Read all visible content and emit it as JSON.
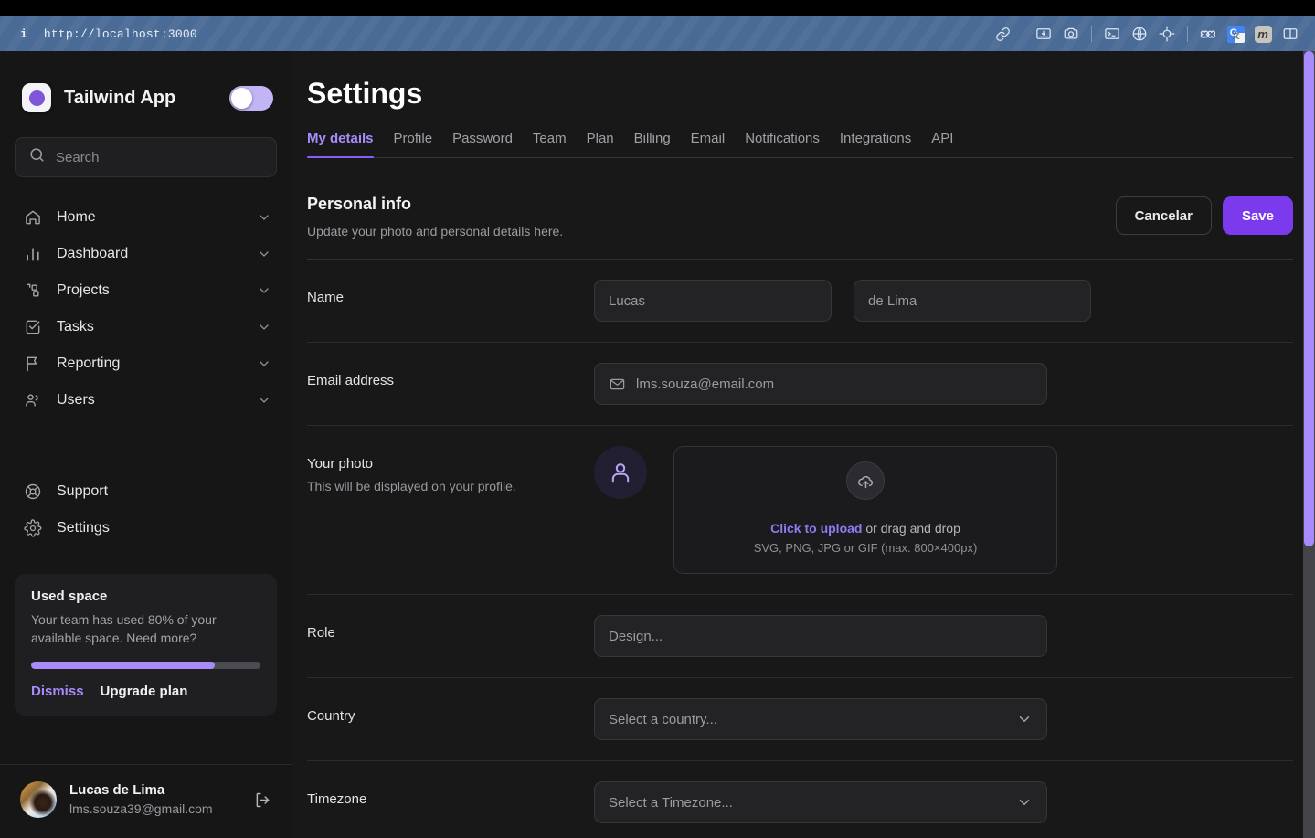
{
  "browser": {
    "info_icon": "info-icon",
    "url": "http://localhost:3000",
    "toolbar_icons": [
      "link-icon",
      "video-save-icon",
      "camera-icon",
      "terminal-icon",
      "globe-icon",
      "target-icon",
      "puzzle-icon",
      "google-translate-icon",
      "mastodon-icon",
      "split-panel-icon"
    ],
    "translate_label": "G",
    "translate_sub": "文",
    "mastodon_label": "m"
  },
  "sidebar": {
    "brand": {
      "name": "Tailwind App",
      "logo_icon": "app-logo-icon"
    },
    "theme_toggle": {
      "state": "off",
      "name": "theme-toggle"
    },
    "search": {
      "placeholder": "Search",
      "icon": "search-icon"
    },
    "nav": [
      {
        "label": "Home",
        "icon": "home-icon"
      },
      {
        "label": "Dashboard",
        "icon": "bar-chart-icon"
      },
      {
        "label": "Projects",
        "icon": "projects-icon"
      },
      {
        "label": "Tasks",
        "icon": "check-square-icon"
      },
      {
        "label": "Reporting",
        "icon": "flag-icon"
      },
      {
        "label": "Users",
        "icon": "users-icon"
      }
    ],
    "nav_secondary": [
      {
        "label": "Support",
        "icon": "lifebuoy-icon"
      },
      {
        "label": "Settings",
        "icon": "gear-icon"
      }
    ],
    "used_space": {
      "title": "Used space",
      "body": "Your team has used 80% of your available space. Need more?",
      "percent": 80,
      "dismiss_label": "Dismiss",
      "upgrade_label": "Upgrade plan",
      "bar_color": "#a78bfa"
    },
    "user": {
      "name": "Lucas de Lima",
      "email": "lms.souza39@gmail.com",
      "avatar": "user-avatar",
      "logout_icon": "logout-icon"
    }
  },
  "main": {
    "page_title": "Settings",
    "tabs": [
      {
        "label": "My details",
        "active": true
      },
      {
        "label": "Profile",
        "active": false
      },
      {
        "label": "Password",
        "active": false
      },
      {
        "label": "Team",
        "active": false
      },
      {
        "label": "Plan",
        "active": false
      },
      {
        "label": "Billing",
        "active": false
      },
      {
        "label": "Email",
        "active": false
      },
      {
        "label": "Notifications",
        "active": false
      },
      {
        "label": "Integrations",
        "active": false
      },
      {
        "label": "API",
        "active": false
      }
    ],
    "section": {
      "title": "Personal info",
      "subtitle": "Update your photo and personal details here.",
      "cancel_label": "Cancelar",
      "save_label": "Save"
    },
    "fields": {
      "name": {
        "label": "Name",
        "first_placeholder": "Lucas",
        "last_placeholder": "de Lima"
      },
      "email": {
        "label": "Email address",
        "placeholder": "lms.souza@email.com",
        "icon": "mail-icon"
      },
      "photo": {
        "label": "Your photo",
        "sublabel": "This will be displayed on your profile.",
        "avatar_icon": "user-placeholder-icon",
        "upload_icon": "cloud-upload-icon",
        "upload_link": "Click to upload",
        "upload_rest": " or drag and drop",
        "upload_hint": "SVG, PNG, JPG or GIF (max. 800×400px)"
      },
      "role": {
        "label": "Role",
        "placeholder": "Design..."
      },
      "country": {
        "label": "Country",
        "placeholder": "Select a country...",
        "icon": "chevron-down-icon"
      },
      "timezone": {
        "label": "Timezone",
        "placeholder": "Select a Timezone...",
        "icon": "chevron-down-icon"
      }
    }
  },
  "colors": {
    "accent": "#7c3aed",
    "accent_light": "#a78bfa",
    "bg": "#181819",
    "sidebar_bg": "#161616",
    "urlbar": "#4a6b96"
  }
}
